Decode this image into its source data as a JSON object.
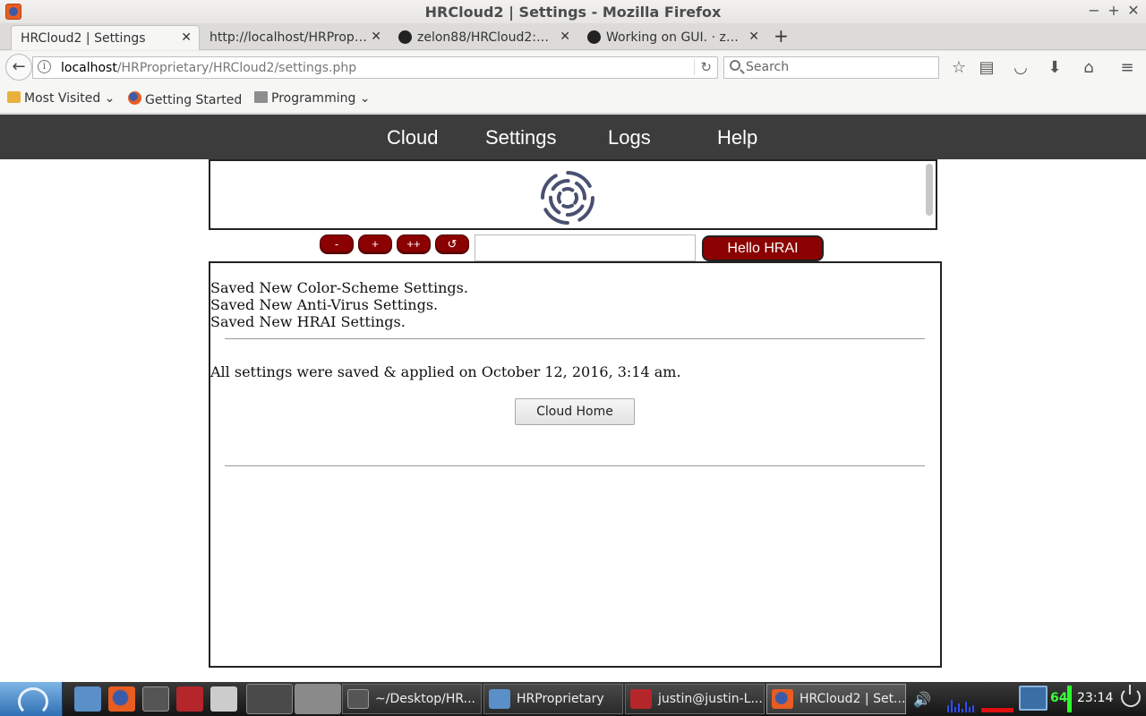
{
  "window": {
    "title": "HRCloud2 | Settings - Mozilla Firefox"
  },
  "tabs": [
    {
      "label": "HRCloud2 | Settings",
      "active": true
    },
    {
      "label": "http://localhost/HRProprietary/HRCloud2/...",
      "active": false
    },
    {
      "label": "zelon88/HRCloud2: ...",
      "active": false
    },
    {
      "label": "Working on GUI. · zelon88/...",
      "active": false
    }
  ],
  "address": {
    "host": "localhost",
    "path": "/HRProprietary/HRCloud2/settings.php"
  },
  "search": {
    "placeholder": "Search"
  },
  "bookmarks": [
    {
      "label": "Most Visited",
      "icon": "star-folder-icon"
    },
    {
      "label": "Getting Started",
      "icon": "firefox-icon"
    },
    {
      "label": "Programming",
      "icon": "folder-icon"
    }
  ],
  "site_nav": [
    "Cloud",
    "Settings",
    "Logs",
    "Help"
  ],
  "controls": {
    "minus": "-",
    "plus": "+",
    "plusplus": "++",
    "refresh": "↺",
    "hello": "Hello HRAI",
    "input_value": ""
  },
  "messages": [
    "Saved New Color-Scheme Settings.",
    "Saved New Anti-Virus Settings.",
    "Saved New HRAI Settings."
  ],
  "summary": "All settings were saved & applied on October 12, 2016, 3:14 am.",
  "home_button": "Cloud Home",
  "taskbar": {
    "tasks": [
      {
        "label": "~/Desktop/HR...",
        "icon": "sublime-icon"
      },
      {
        "label": "HRProprietary",
        "icon": "folder-icon"
      },
      {
        "label": "justin@justin-L...",
        "icon": "terminal-icon"
      },
      {
        "label": "HRCloud2 | Set...",
        "icon": "firefox-icon"
      }
    ],
    "tray_number": "64",
    "clock": "23:14"
  },
  "colors": {
    "site_nav_bg": "#3c3c3c",
    "button_red": "#8b0000"
  }
}
